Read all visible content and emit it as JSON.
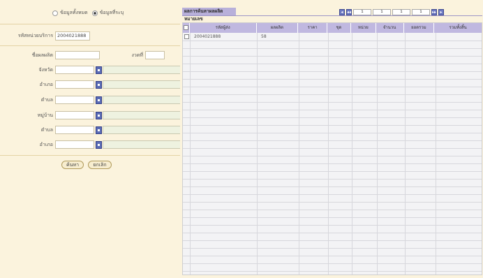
{
  "search_mode": {
    "options": [
      "ข้อมูลทั้งหมด",
      "ข้อมูลที่ระบุ"
    ],
    "selected_index": 1
  },
  "form": {
    "service_code_label": "รหัสหน่วยบริการ",
    "service_code_value": "2004021888",
    "product_label": "ชื่อผลผลิต",
    "product_value": "",
    "month_label": "งวดที่",
    "month_value": "",
    "fields": [
      {
        "label": "จังหวัด"
      },
      {
        "label": "อำเภอ"
      },
      {
        "label": "ตำบล"
      },
      {
        "label": "หมู่บ้าน"
      },
      {
        "label": "ตำบล"
      },
      {
        "label": "อำเภอ"
      }
    ]
  },
  "buttons": {
    "search_label": "ค้นหา",
    "clear_label": "ยกเลิก"
  },
  "results": {
    "tab_label": "ผลการค้นหาผลผลิตหมายเลข",
    "pagination": {
      "current_page": "1",
      "page_a": "1",
      "page_b": "1",
      "page_c": "1"
    },
    "columns": [
      "",
      "รหัสผู้ส่ง",
      "ผลผลิต",
      "ราคา",
      "ชุด",
      "หน่วย",
      "จำนวน",
      "ยอดรวม",
      "รวมทั้งสิ้น"
    ],
    "rows": [
      [
        "",
        "2004021888",
        "58",
        "",
        "",
        "",
        "",
        "",
        ""
      ]
    ]
  }
}
